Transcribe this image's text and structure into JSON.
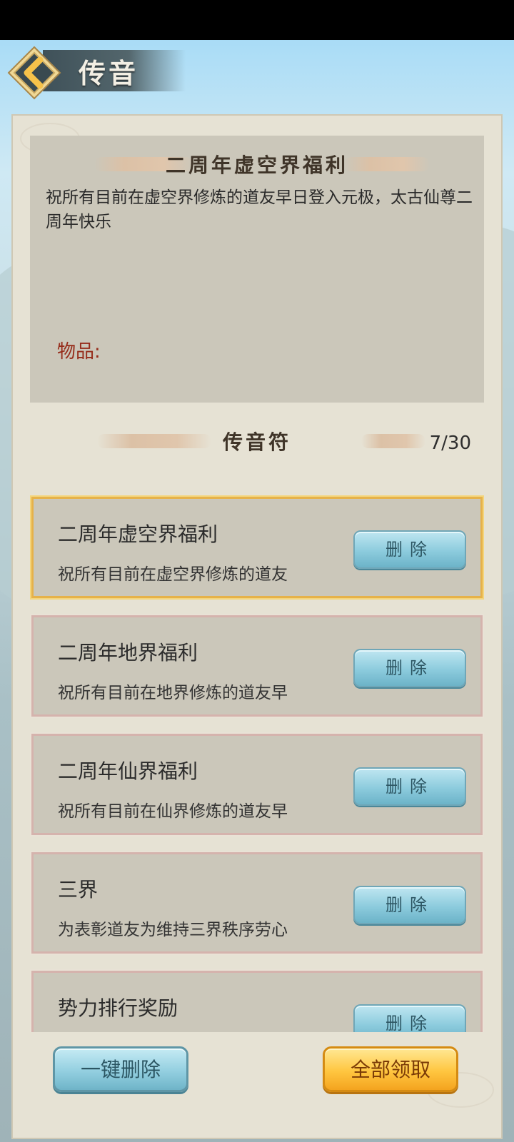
{
  "header": {
    "title": "传音"
  },
  "detail": {
    "title": "二周年虚空界福利",
    "body": "祝所有目前在虚空界修炼的道友早日登入元极，太古仙尊二周年快乐",
    "items_label": "物品:"
  },
  "list": {
    "section_title": "传音符",
    "count": "7/30",
    "delete_label": "删除",
    "items": [
      {
        "title": "二周年虚空界福利",
        "preview": "祝所有目前在虚空界修炼的道友",
        "selected": true
      },
      {
        "title": "二周年地界福利",
        "preview": "祝所有目前在地界修炼的道友早",
        "selected": false
      },
      {
        "title": "二周年仙界福利",
        "preview": "祝所有目前在仙界修炼的道友早",
        "selected": false
      },
      {
        "title": "三界",
        "preview": "为表彰道友为维持三界秩序劳心",
        "selected": false
      },
      {
        "title": "势力排行奖励",
        "preview": "",
        "selected": false
      }
    ]
  },
  "footer": {
    "delete_all_label": "一键删除",
    "claim_all_label": "全部领取"
  },
  "colors": {
    "accent_gold": "#f4a41f",
    "button_blue": "#8ccbdd",
    "item_label_red": "#962c1a"
  }
}
